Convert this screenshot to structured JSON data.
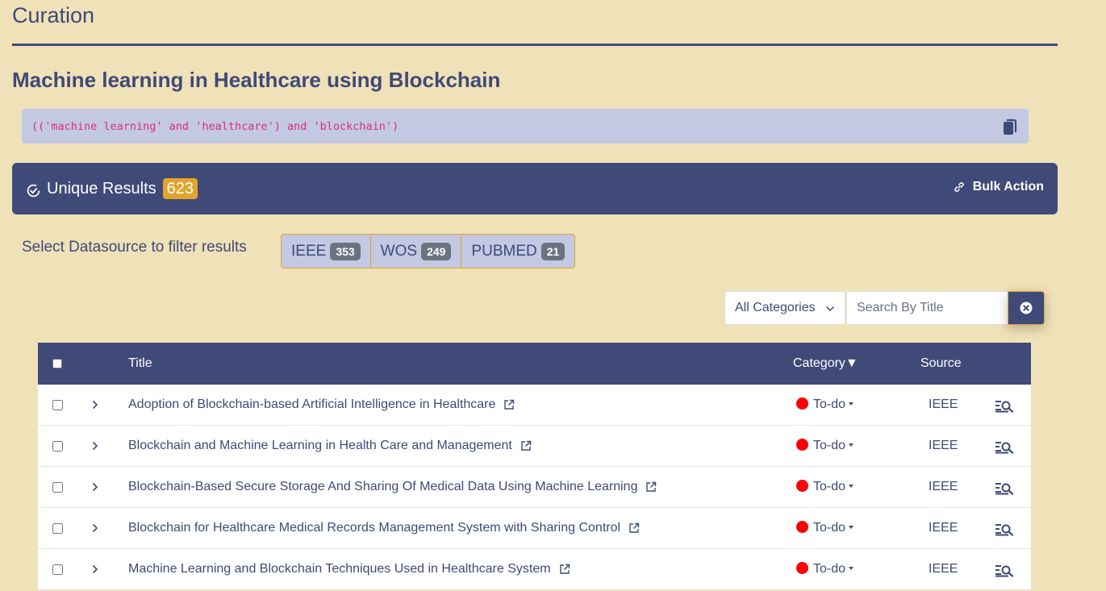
{
  "page": {
    "title": "Curation"
  },
  "query": {
    "title": "Machine learning in Healthcare using Blockchain",
    "expression": "(('machine learning' and 'healthcare') and 'blockchain')"
  },
  "results": {
    "label": "Unique Results",
    "count": "623",
    "bulk_action_label": "Bulk Action"
  },
  "datasources": {
    "label": "Select Datasource to filter results",
    "items": [
      {
        "name": "IEEE",
        "count": "353"
      },
      {
        "name": "WOS",
        "count": "249"
      },
      {
        "name": "PUBMED",
        "count": "21"
      }
    ]
  },
  "filters": {
    "category_selected": "All Categories",
    "search_placeholder": "Search By Title"
  },
  "table": {
    "headers": {
      "title": "Title",
      "category": "Category▼",
      "source": "Source"
    },
    "rows": [
      {
        "title": "Adoption of Blockchain-based Artificial Intelligence in Healthcare",
        "category": "To-do",
        "source": "IEEE"
      },
      {
        "title": "Blockchain and Machine Learning in Health Care and Management",
        "category": "To-do",
        "source": "IEEE"
      },
      {
        "title": "Blockchain-Based Secure Storage And Sharing Of Medical Data Using Machine Learning",
        "category": "To-do",
        "source": "IEEE"
      },
      {
        "title": "Blockchain for Healthcare Medical Records Management System with Sharing Control",
        "category": "To-do",
        "source": "IEEE"
      },
      {
        "title": "Machine Learning and Blockchain Techniques Used in Healthcare System",
        "category": "To-do",
        "source": "IEEE"
      }
    ]
  },
  "colors": {
    "background": "#efe1b8",
    "primary": "#404a78",
    "accent": "#e1a52c",
    "todo_dot": "#fb0007",
    "query_bg": "#c3c8e3"
  }
}
